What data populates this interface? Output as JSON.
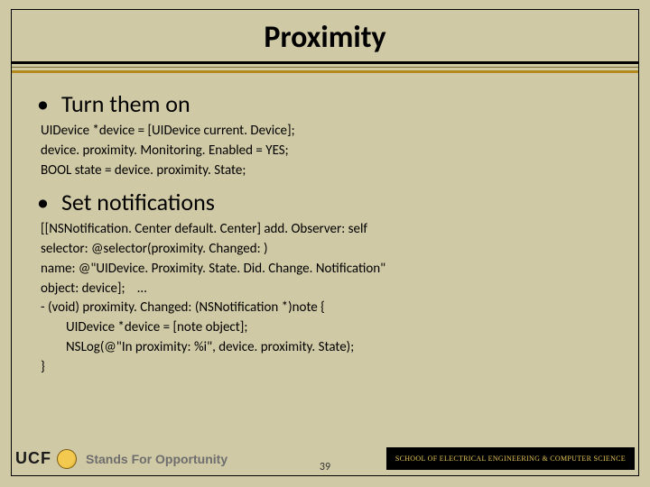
{
  "title": "Proximity",
  "bullets": {
    "b1": {
      "dot": "•",
      "text": "Turn them on"
    },
    "b2": {
      "dot": "•",
      "text": "Set notifications"
    }
  },
  "code1": {
    "l1": "UIDevice *device = [UIDevice current. Device];",
    "l2": "device. proximity. Monitoring. Enabled = YES;",
    "l3": "BOOL state = device. proximity. State;"
  },
  "code2": {
    "l1": "[[NSNotification. Center default. Center] add. Observer: self",
    "l2": "selector: @selector(proximity. Changed: )",
    "l3": "name: @\"UIDevice. Proximity. State. Did. Change. Notification\"",
    "l4": "object: device];    …",
    "l5": "- (void) proximity. Changed: (NSNotification *)note {",
    "l6": "UIDevice *device = [note object];",
    "l7": "NSLog(@\"In proximity: %i\", device. proximity. State);",
    "l8": "}"
  },
  "footer": {
    "ucf": "UCF",
    "tagline": "Stands For Opportunity",
    "school": "SCHOOL OF ELECTRICAL ENGINEERING & COMPUTER SCIENCE"
  },
  "page_number": "39"
}
